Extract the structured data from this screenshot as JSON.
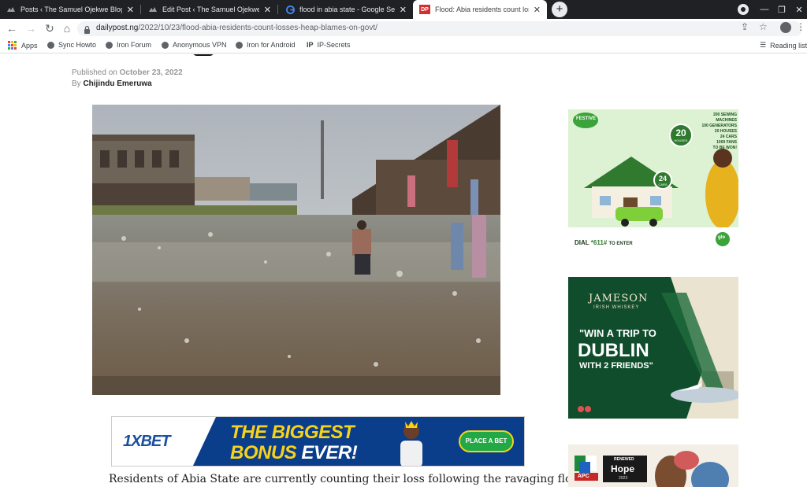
{
  "tabs": [
    {
      "title": "Posts ‹ The Samuel Ojekwe Blog",
      "favicon": "wordpress-icon"
    },
    {
      "title": "Edit Post ‹ The Samuel Ojekwe Blog",
      "favicon": "wordpress-icon"
    },
    {
      "title": "flood in abia state - Google Search",
      "favicon": "google-icon"
    },
    {
      "title": "Flood: Abia residents count losses",
      "favicon_text": "DP",
      "active": true
    }
  ],
  "toolbar": {
    "url_host": "dailypost.ng",
    "url_path": "/2022/10/23/flood-abia-residents-count-losses-heap-blames-on-govt/"
  },
  "bookmarks": [
    {
      "label": "Apps",
      "icon": "apps-grid-icon"
    },
    {
      "label": "Sync Howto",
      "icon": "globe-icon"
    },
    {
      "label": "Iron Forum",
      "icon": "globe-icon"
    },
    {
      "label": "Anonymous VPN",
      "icon": "globe-icon"
    },
    {
      "label": "Iron for Android",
      "icon": "globe-icon"
    },
    {
      "label": "IP-Secrets",
      "icon_text": "IP"
    }
  ],
  "reading_list": "Reading list",
  "article": {
    "published_prefix": "Published on",
    "published_date": "October 23, 2022",
    "by_prefix": "By",
    "author": "Chijindu Emeruwa",
    "first_line": "Residents of Abia State are currently counting their loss following the ravaging flood"
  },
  "ads": {
    "xbet": {
      "logo": "1XBET",
      "line1": "THE BIGGEST",
      "line2a": "BONUS",
      "line2b": "EVER!",
      "cta": "PLACE A BET"
    },
    "festive": {
      "badge": "FESTIVE",
      "houses_count": "20",
      "houses_label": "HOUSES",
      "cars_count": "24",
      "cars_label": "CARS",
      "list": "200 SEWING MACHINES\n100 GENERATORS\n20 HOUSES\n24 CARS\n1000 FANS\nTO BE WON!",
      "dial_prefix": "DIAL",
      "dial_code": "*611#",
      "dial_suffix": "TO ENTER",
      "brand": "glo"
    },
    "jameson": {
      "brand": "JAMESON",
      "sub": "IRISH WHISKEY",
      "line1": "\"WIN A TRIP TO",
      "line2": "DUBLIN",
      "line3": "WITH 2 FRIENDS\""
    },
    "apc": {
      "party": "APC",
      "slogan_top": "RENEWED",
      "slogan_main": "Hope",
      "slogan_year": "2023"
    }
  },
  "colors": {
    "tabstrip_bg": "#202124",
    "accent_green": "#22a845",
    "xbet_blue": "#0a3d8a",
    "xbet_yellow": "#f7d21b",
    "jameson_green": "#0f4d2c"
  }
}
